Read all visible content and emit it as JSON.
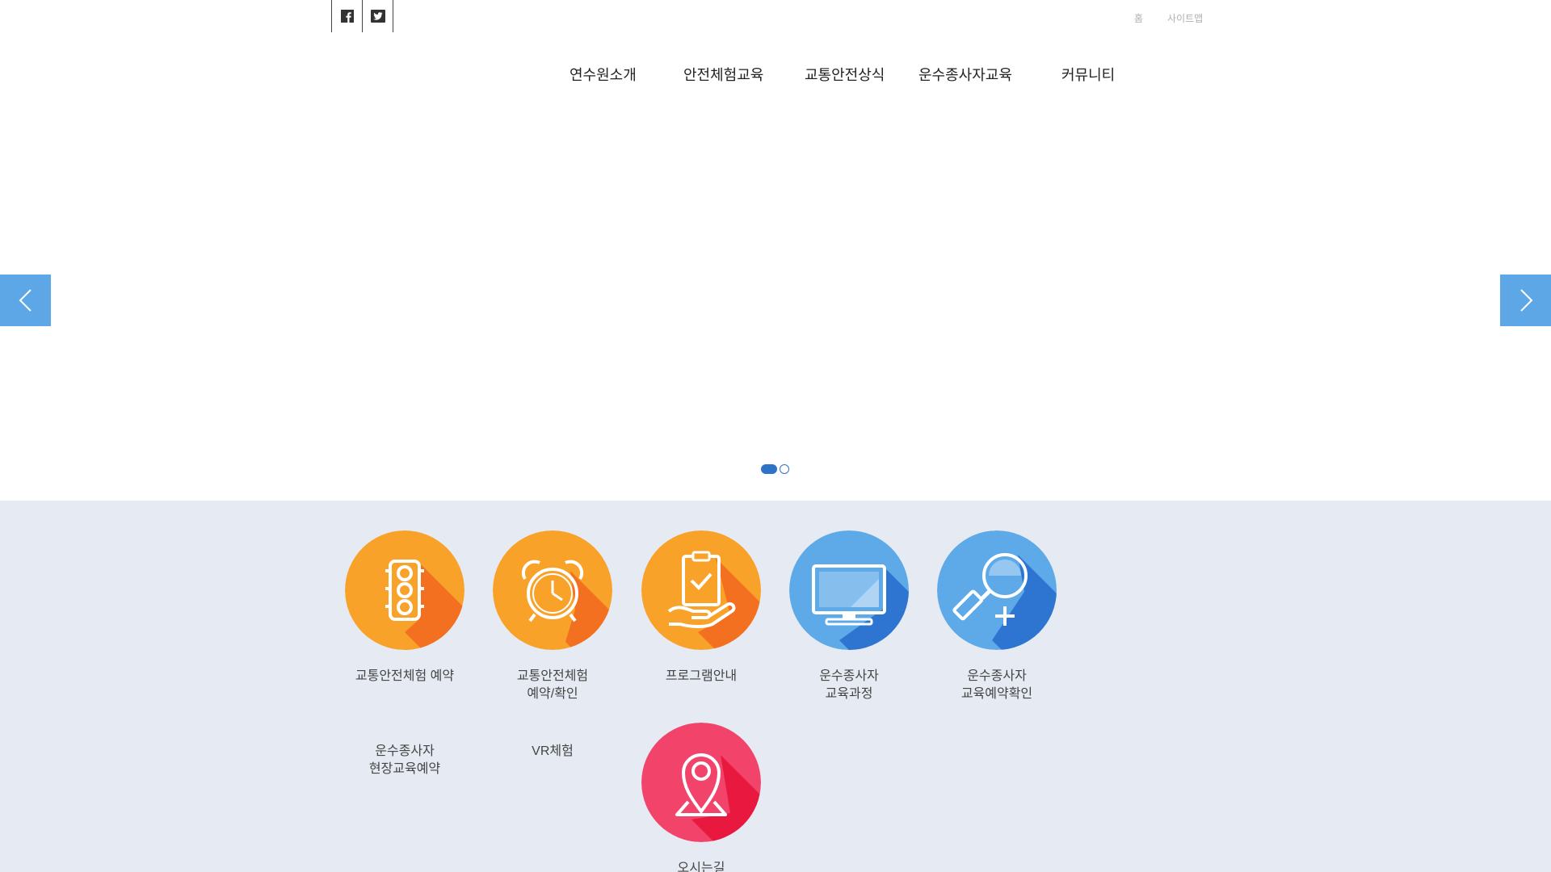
{
  "utility": {
    "home": "홈",
    "sitemap": "사이트맵"
  },
  "social": {
    "facebook_icon": "facebook-icon",
    "twitter_icon": "twitter-icon"
  },
  "nav": {
    "items": [
      {
        "label": "연수원소개"
      },
      {
        "label": "안전체험교육"
      },
      {
        "label": "교통안전상식"
      },
      {
        "label": "운수종사자교육"
      },
      {
        "label": "커뮤니티"
      }
    ]
  },
  "slider": {
    "slides": 2,
    "active": 0,
    "arrow_color": "#5ea7e6",
    "dot_color": "#2f73c9"
  },
  "quick_menu": {
    "items": [
      {
        "label": "교통안전체험 예약",
        "icon": "traffic-light-icon",
        "color": "#f9a22a"
      },
      {
        "label": "교통안전체험\n예약/확인",
        "icon": "alarm-clock-icon",
        "color": "#f9a22a"
      },
      {
        "label": "프로그램안내",
        "icon": "clipboard-check-icon",
        "color": "#f9a22a"
      },
      {
        "label": "운수종사자\n교육과정",
        "icon": "monitor-icon",
        "color": "#5eaae8"
      },
      {
        "label": "운수종사자\n교육예약확인",
        "icon": "magnifier-plus-icon",
        "color": "#5eaae8"
      },
      {
        "label": "운수종사자\n현장교육예약",
        "icon": "",
        "color": ""
      },
      {
        "label": "VR체험",
        "icon": "",
        "color": ""
      },
      {
        "label": "오시는길",
        "icon": "map-pin-icon",
        "color": "#f2436a"
      }
    ]
  }
}
